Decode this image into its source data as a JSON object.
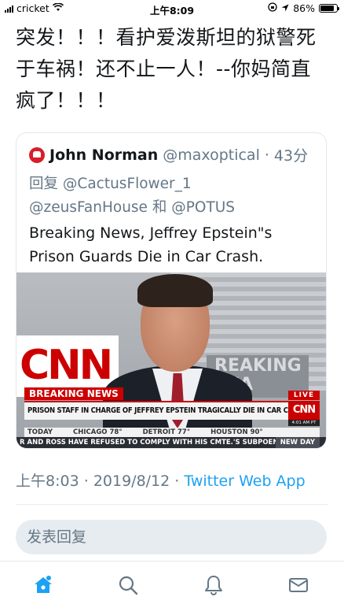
{
  "status_bar": {
    "carrier": "cricket",
    "time": "上午8:09",
    "battery": "86%",
    "battery_level": 0.86
  },
  "tweet": {
    "text": "突发！！！看护爱泼斯坦的狱警死于车祸！还不止一人！--你妈简直疯了！！！"
  },
  "quoted_tweet": {
    "name": "John Norman",
    "handle": "@maxoptical",
    "separator": "·",
    "time": "43分",
    "reply_prefix": "回复",
    "reply_to_1": "@CactusFlower_1",
    "reply_to_2": "@zeusFanHouse",
    "reply_and": "和",
    "reply_to_3": "@POTUS",
    "text": "Breaking News,  Jeffrey Epstein\"s Prison Guards Die in Car Crash.",
    "image": {
      "wall_logo": "CNN",
      "wall_text": "REAKING REA",
      "breaking_label": "BREAKING NEWS",
      "live_label": "LIVE",
      "headline": "PRISON STAFF IN CHARGE OF JEFFREY EPSTEIN TRAGICALLY DIE IN CAR CRASH TOMORROW",
      "network_logo": "CNN",
      "clock": "4:01 AM PT",
      "ticker_weather": [
        {
          "city": "TODAY",
          "temp": ""
        },
        {
          "city": "CHICAGO",
          "temp": "78°"
        },
        {
          "city": "DETROIT",
          "temp": "77°"
        },
        {
          "city": "HOUSTON",
          "temp": "90°"
        }
      ],
      "ticker_news": "R AND ROSS HAVE REFUSED TO COMPLY WITH HIS CMTE.'S SUBPOENAS FOR",
      "ticker_tag": "NEW DAY"
    }
  },
  "meta": {
    "time": "上午8:03",
    "sep1": "·",
    "date": "2019/8/12",
    "sep2": "·",
    "source": "Twitter Web App"
  },
  "reply_box": {
    "placeholder": "发表回复"
  },
  "tabbar": {
    "icons": [
      "home-icon",
      "search-icon",
      "notifications-icon",
      "messages-icon"
    ],
    "active_color": "#1da1f2",
    "inactive_color": "#657786"
  }
}
